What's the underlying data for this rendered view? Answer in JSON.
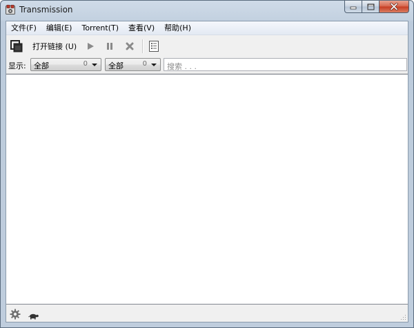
{
  "window": {
    "title": "Transmission",
    "icon": "transmission-app-icon",
    "caption_buttons": [
      "minimize-icon",
      "maximize-icon",
      "close-icon"
    ]
  },
  "menu": {
    "items": [
      {
        "label": "文件(F)"
      },
      {
        "label": "编辑(E)"
      },
      {
        "label": "Torrent(T)"
      },
      {
        "label": "查看(V)"
      },
      {
        "label": "帮助(H)"
      }
    ]
  },
  "toolbar": {
    "open_icon": "open-torrent-icon",
    "open_url_label": "打开链接 (U)",
    "start_icon": "play-icon",
    "pause_icon": "pause-icon",
    "remove_icon": "remove-x-icon",
    "properties_icon": "properties-list-icon"
  },
  "filter": {
    "label": "显示:",
    "activity": {
      "value": "全部",
      "count": "0"
    },
    "tracker": {
      "value": "全部",
      "count": "0"
    },
    "search_placeholder": "搜索 . . ."
  },
  "statusbar": {
    "prefs_icon": "gear-icon",
    "speed_limit_icon": "turtle-icon",
    "grip_icon": "resize-grip-icon"
  },
  "colors": {
    "accent": "#c63c22",
    "frame": "#bfcddd",
    "list_bg": "#ffffff"
  }
}
